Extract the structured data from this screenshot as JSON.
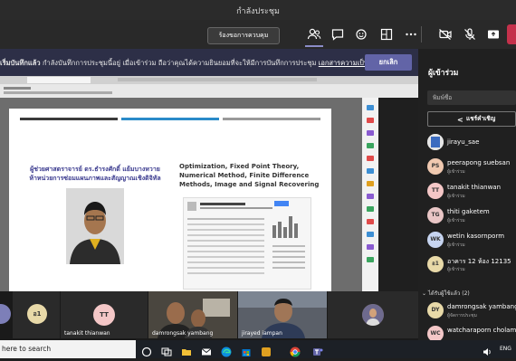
{
  "window": {
    "title": "กำลังประชุม"
  },
  "toolbar": {
    "request_control_label": "ร้องขอการควบคุม",
    "icons": [
      "people-icon",
      "chat-icon",
      "reactions-icon",
      "rooms-icon",
      "more-icon",
      "camera-off-icon",
      "mic-off-icon",
      "share-tray-icon"
    ]
  },
  "banner": {
    "lead": "เริ่มบันทึกแล้ว",
    "message": " กำลังบันทึกการประชุมนี้อยู่ เมื่อเข้าร่วม ถือว่าคุณได้ความยินยอมที่จะให้มีการบันทึกการประชุม ",
    "link": "เอกสารความเป็นส่วนตัว",
    "dismiss_label": "ยกเลิก"
  },
  "shared_screen": {
    "slide": {
      "presenter_name": "ผู้ช่วยศาสตราจารย์ ดร.ธำรงศักดิ์ แย้มบางหวาย",
      "presenter_affiliation": "ห้าหน่วยการซ่อมแผนภาพและสัญญาณเชิงดิจิทัล",
      "topic": "Optimization, Fixed Point Theory, Numerical Method, Finite Difference Methods, Image and Signal Recovering"
    }
  },
  "participants": {
    "title": "ผู้เข้าร่วม",
    "search_placeholder": "พิมพ์ชื่อ",
    "share_invite_label": "แชร์คำเชิญ",
    "list": [
      {
        "initials": "",
        "name": "jirayu_sae",
        "role": "",
        "color": "#e6e6e6"
      },
      {
        "initials": "PS",
        "name": "peerapong suebsan",
        "role": "ผู้เข้าร่วม",
        "color": "#f0c9b0"
      },
      {
        "initials": "TT",
        "name": "tanakit thianwan",
        "role": "ผู้เข้าร่วม",
        "color": "#f4c7c7"
      },
      {
        "initials": "TG",
        "name": "thiti gaketem",
        "role": "ผู้เข้าร่วม",
        "color": "#e9c6c6"
      },
      {
        "initials": "WK",
        "name": "wetin kasornporm",
        "role": "ผู้เข้าร่วม",
        "color": "#c6d4f0"
      },
      {
        "initials": "อ1",
        "name": "อาคาร 12 ห้อง 12135",
        "role": "ผู้เข้าร่วม",
        "color": "#e8d9a8"
      }
    ],
    "section_label": "ได้รับผู้ใช้แล้ว (2)",
    "invited": [
      {
        "initials": "DY",
        "name": "damrongsak yambang",
        "role": "ผู้จัดการประชุม",
        "color": "#e8d9a8"
      },
      {
        "initials": "WC",
        "name": "watcharaporn cholamj",
        "role": "",
        "color": "#f4c7c7"
      }
    ]
  },
  "video_strip": {
    "tiles": [
      {
        "initials": "อ1",
        "name": ""
      },
      {
        "initials": "TT",
        "name": "tanakit thianwan"
      },
      {
        "name": "damrongsak yambang"
      },
      {
        "name": "jirayu_sae"
      },
      {
        "name": "jirayed iampan"
      },
      {
        "name": ""
      }
    ]
  },
  "taskbar": {
    "search_text": "here to search",
    "lang": "ENG"
  }
}
